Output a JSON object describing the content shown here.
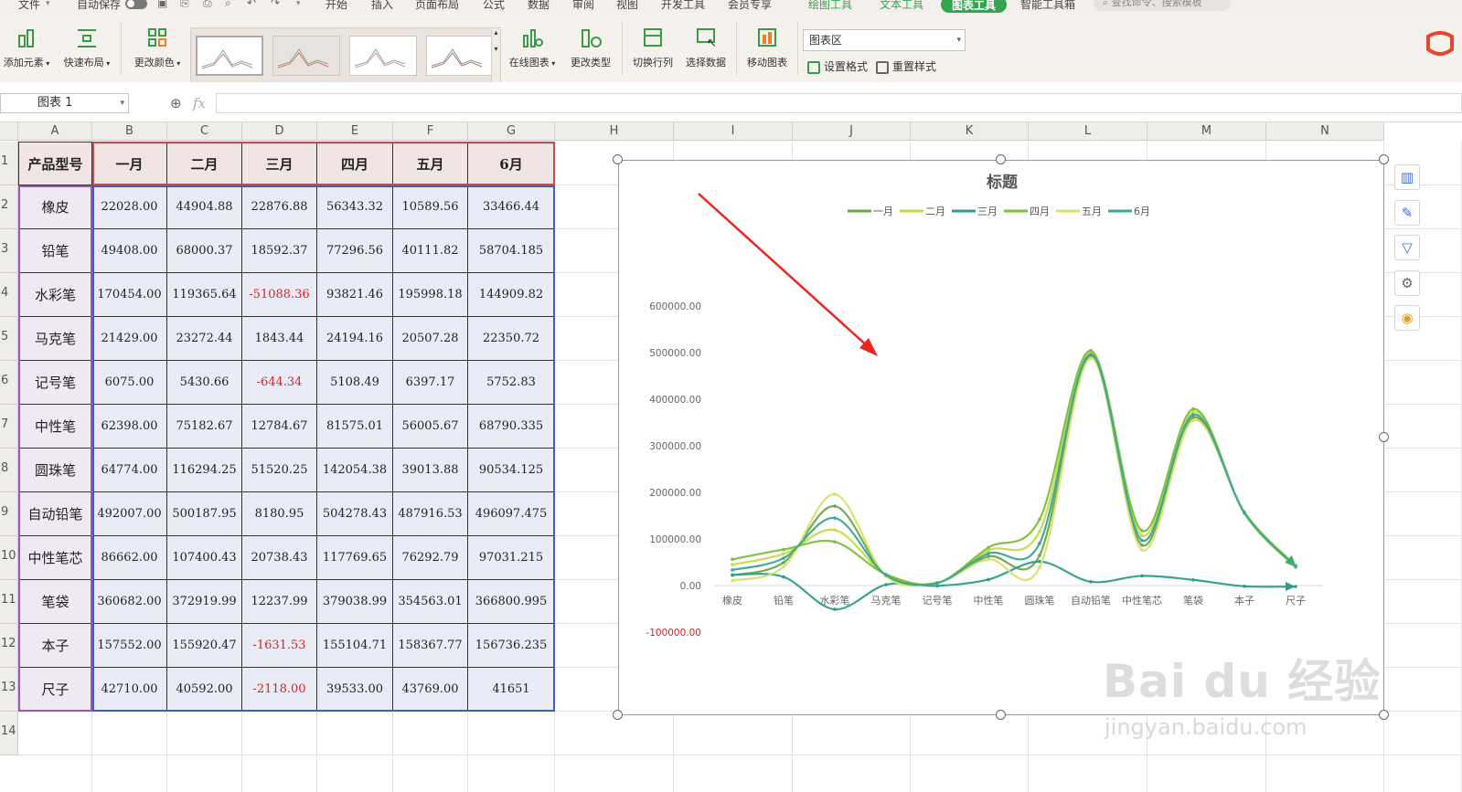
{
  "menubar": {
    "items": [
      "文件",
      "自动保存",
      "开始",
      "插入",
      "页面布局",
      "公式",
      "数据",
      "审阅",
      "视图",
      "开发工具",
      "会员专享",
      "绘图工具",
      "文本工具",
      "图表工具",
      "智能工具箱"
    ],
    "search_placeholder": "查找命令、搜索模板"
  },
  "ribbon": {
    "buttons": [
      "添加元素",
      "快速布局",
      "更改颜色",
      "在线图表",
      "更改类型",
      "切换行列",
      "选择数据",
      "移动图表"
    ],
    "chart_area_value": "图表区",
    "set_format": "设置格式",
    "reset_style": "重置样式"
  },
  "formula": {
    "name_box": "图表 1",
    "fx": "fx"
  },
  "columns": [
    "A",
    "B",
    "C",
    "D",
    "E",
    "F",
    "G",
    "H",
    "I",
    "J",
    "K",
    "L",
    "M",
    "N"
  ],
  "rows": [
    "1",
    "2",
    "3",
    "4",
    "5",
    "6",
    "7",
    "8",
    "9",
    "10",
    "11",
    "12",
    "13",
    "14"
  ],
  "table": {
    "headers": [
      "产品型号",
      "一月",
      "二月",
      "三月",
      "四月",
      "五月",
      "6月"
    ],
    "rows": [
      [
        "橡皮",
        "22028.00",
        "44904.88",
        "22876.88",
        "56343.32",
        "10589.56",
        "33466.44"
      ],
      [
        "铅笔",
        "49408.00",
        "68000.37",
        "18592.37",
        "77296.56",
        "40111.82",
        "58704.185"
      ],
      [
        "水彩笔",
        "170454.00",
        "119365.64",
        "-51088.36",
        "93821.46",
        "195998.18",
        "144909.82"
      ],
      [
        "马克笔",
        "21429.00",
        "23272.44",
        "1843.44",
        "24194.16",
        "20507.28",
        "22350.72"
      ],
      [
        "记号笔",
        "6075.00",
        "5430.66",
        "-644.34",
        "5108.49",
        "6397.17",
        "5752.83"
      ],
      [
        "中性笔",
        "62398.00",
        "75182.67",
        "12784.67",
        "81575.01",
        "56005.67",
        "68790.335"
      ],
      [
        "圆珠笔",
        "64774.00",
        "116294.25",
        "51520.25",
        "142054.38",
        "39013.88",
        "90534.125"
      ],
      [
        "自动铅笔",
        "492007.00",
        "500187.95",
        "8180.95",
        "504278.43",
        "487916.53",
        "496097.475"
      ],
      [
        "中性笔芯",
        "86662.00",
        "107400.43",
        "20738.43",
        "117769.65",
        "76292.79",
        "97031.215"
      ],
      [
        "笔袋",
        "360682.00",
        "372919.99",
        "12237.99",
        "379038.99",
        "354563.01",
        "366800.995"
      ],
      [
        "本子",
        "157552.00",
        "155920.47",
        "-1631.53",
        "155104.71",
        "158367.77",
        "156736.235"
      ],
      [
        "尺子",
        "42710.00",
        "40592.00",
        "-2118.00",
        "39533.00",
        "43769.00",
        "41651"
      ]
    ]
  },
  "chart_data": {
    "type": "line",
    "title": "标题",
    "categories": [
      "橡皮",
      "铅笔",
      "水彩笔",
      "马克笔",
      "记号笔",
      "中性笔",
      "圆珠笔",
      "自动铅笔",
      "中性笔芯",
      "笔袋",
      "本子",
      "尺子"
    ],
    "series": [
      {
        "name": "一月",
        "color": "#6aa84f",
        "values": [
          22028,
          49408,
          170454,
          21429,
          6075,
          62398,
          64774,
          492007,
          86662,
          360682,
          157552,
          42710
        ]
      },
      {
        "name": "二月",
        "color": "#c9d94a",
        "values": [
          44904.88,
          68000.37,
          119365.64,
          23272.44,
          5430.66,
          75182.67,
          116294.25,
          500187.95,
          107400.43,
          372919.99,
          155920.47,
          40592
        ]
      },
      {
        "name": "三月",
        "color": "#2e9e8a",
        "values": [
          22876.88,
          18592.37,
          -51088.36,
          1843.44,
          -644.34,
          12784.67,
          51520.25,
          8180.95,
          20738.43,
          12237.99,
          -1631.53,
          -2118
        ]
      },
      {
        "name": "四月",
        "color": "#7cbf3a",
        "values": [
          56343.32,
          77296.56,
          93821.46,
          24194.16,
          5108.49,
          81575.01,
          142054.38,
          504278.43,
          117769.65,
          379038.99,
          155104.71,
          39533
        ]
      },
      {
        "name": "五月",
        "color": "#d8e06a",
        "values": [
          10589.56,
          40111.82,
          195998.18,
          20507.28,
          6397.17,
          56005.67,
          39013.88,
          487916.53,
          76292.79,
          354563.01,
          158367.77,
          43769
        ]
      },
      {
        "name": "6月",
        "color": "#3aa890",
        "values": [
          33466.44,
          58704.185,
          144909.82,
          22350.72,
          5752.83,
          68790.335,
          90534.125,
          496097.475,
          97031.215,
          366800.995,
          156736.235,
          41651
        ]
      }
    ],
    "yticks": [
      "600000.00",
      "500000.00",
      "400000.00",
      "300000.00",
      "200000.00",
      "100000.00",
      "0.00",
      "-100000.00"
    ],
    "ylim": [
      -100000,
      600000
    ],
    "legend_position": "top",
    "grid": false,
    "negative_tick_color": "#e02020"
  },
  "watermark": {
    "main": "Bai du 经验",
    "sub": "jingyan.baidu.com"
  }
}
